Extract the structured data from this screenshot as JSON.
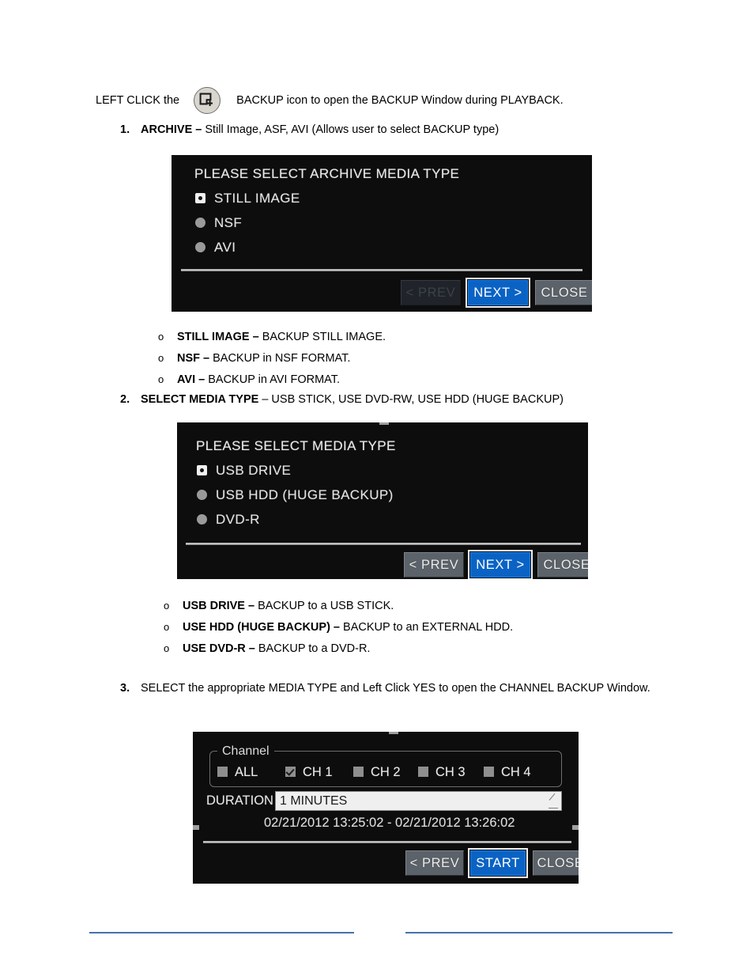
{
  "page": {
    "intro": {
      "before_icon": "LEFT CLICK the",
      "icon": "backup-icon",
      "after_icon": "BACKUP icon to open the BACKUP Window during PLAYBACK."
    },
    "steps": [
      {
        "marker": "1.",
        "bold": "ARCHIVE –",
        "rest": " Still Image, ASF, AVI (Allows user to select BACKUP type)"
      },
      {
        "marker": "2.",
        "bold": "SELECT MEDIA TYPE",
        "rest": " – USB STICK, USE DVD-RW, USE HDD (HUGE BACKUP)"
      },
      {
        "marker": "3.",
        "bold": "",
        "rest": "SELECT the appropriate MEDIA TYPE and Left Click YES to open the CHANNEL BACKUP Window."
      }
    ],
    "bullets_group_one": [
      {
        "marker": "o",
        "bold": "STILL IMAGE –",
        "rest": " BACKUP STILL IMAGE."
      },
      {
        "marker": "o",
        "bold": "NSF –",
        "rest": " BACKUP in NSF FORMAT."
      },
      {
        "marker": "o",
        "bold": "AVI –",
        "rest": " BACKUP in AVI FORMAT."
      }
    ],
    "bullets_group_two": [
      {
        "marker": "o",
        "bold": "USB DRIVE –",
        "rest": " BACKUP to a USB STICK."
      },
      {
        "marker": "o",
        "bold": "USE HDD (HUGE BACKUP) –",
        "rest": " BACKUP to an EXTERNAL HDD."
      },
      {
        "marker": "o",
        "bold": "USE DVD-R  –",
        "rest": " BACKUP to a DVD-R."
      }
    ],
    "footer": {
      "rule_color": "#4472a8"
    }
  },
  "dialog_archive": {
    "title": "PLEASE SELECT ARCHIVE MEDIA TYPE",
    "options": [
      {
        "label": "STILL IMAGE",
        "selected": true
      },
      {
        "label": "NSF",
        "selected": false
      },
      {
        "label": "AVI",
        "selected": false
      }
    ],
    "buttons": [
      {
        "label": "< PREV",
        "state": "disabled"
      },
      {
        "label": "NEXT >",
        "state": "primary"
      },
      {
        "label": "CLOSE",
        "state": "normal"
      }
    ]
  },
  "dialog_media": {
    "title": "PLEASE SELECT MEDIA TYPE",
    "options": [
      {
        "label": "USB DRIVE",
        "selected": true
      },
      {
        "label": "USB HDD (HUGE BACKUP)",
        "selected": false
      },
      {
        "label": "DVD-R",
        "selected": false
      }
    ],
    "buttons": [
      {
        "label": "< PREV",
        "state": "normal"
      },
      {
        "label": "NEXT >",
        "state": "primary"
      },
      {
        "label": "CLOSE",
        "state": "normal"
      }
    ]
  },
  "dialog_channel": {
    "group_legend": "Channel",
    "channels": [
      {
        "label": "ALL",
        "checked": false
      },
      {
        "label": "CH 1",
        "checked": true
      },
      {
        "label": "CH 2",
        "checked": false
      },
      {
        "label": "CH 3",
        "checked": false
      },
      {
        "label": "CH 4",
        "checked": false
      }
    ],
    "duration_label": "DURATION",
    "duration_value": "1 MINUTES",
    "time_range": "02/21/2012 13:25:02 - 02/21/2012 13:26:02",
    "buttons": [
      {
        "label": "< PREV",
        "state": "normal"
      },
      {
        "label": "START",
        "state": "primary"
      },
      {
        "label": "CLOSE",
        "state": "normal"
      }
    ]
  },
  "colors": {
    "dialog_bg": "#0d0d0d",
    "primary_button": "#0a63c4",
    "normal_button": "#5b6269",
    "disabled_button": "#20242a",
    "footer_rule": "#4472a8"
  }
}
